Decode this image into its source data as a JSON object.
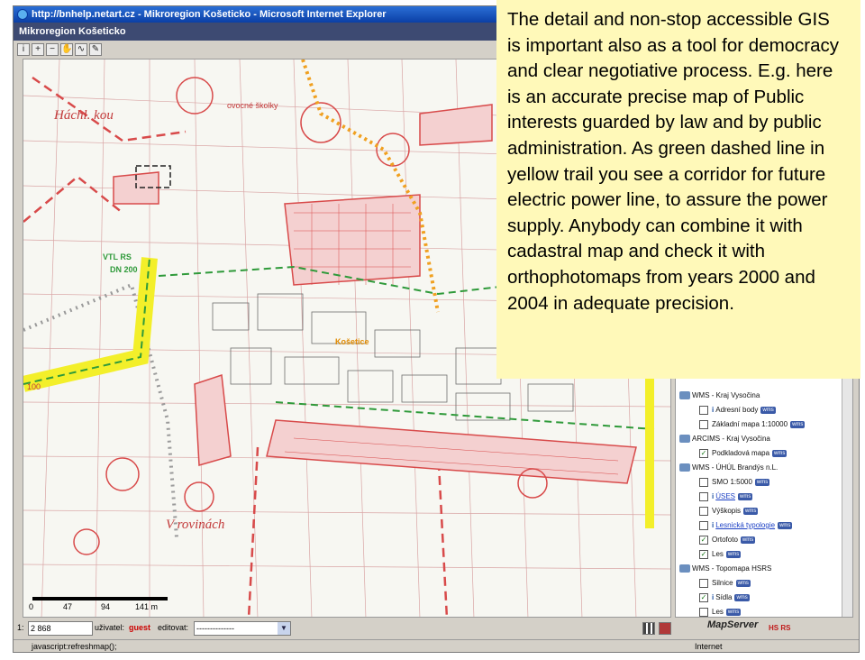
{
  "window": {
    "title": "http://bnhelp.netart.cz - Mikroregion Košeticko - Microsoft Internet Explorer"
  },
  "app": {
    "header": "Mikroregion Košeticko"
  },
  "toolbar": {
    "tools": [
      "info",
      "zoom-in",
      "zoom-out",
      "pan",
      "measure",
      "draw"
    ]
  },
  "map": {
    "labels": {
      "place_north": "Háchl. kou",
      "place_south": "V rovinách",
      "town": "Košetice",
      "corridor": "VTL RS",
      "corridor_sub": "DN 200",
      "schools": "ovocné školky",
      "line_number": "100"
    },
    "scale": {
      "ticks": [
        "0",
        "47",
        "94",
        "141 m"
      ]
    }
  },
  "layers": [
    {
      "kind": "group",
      "label": "WMS - Kraj Vysočina"
    },
    {
      "kind": "item",
      "label": "Adresní body",
      "checked": false,
      "info": true,
      "wms": true
    },
    {
      "kind": "item",
      "label": "Základní mapa 1:10000",
      "checked": false,
      "info": false,
      "wms": true
    },
    {
      "kind": "group",
      "label": "ARCIMS - Kraj Vysočina"
    },
    {
      "kind": "item",
      "label": "Podkladová mapa",
      "checked": true,
      "info": false,
      "wms": true
    },
    {
      "kind": "group",
      "label": "WMS - ÚHÚL Brandýs n.L."
    },
    {
      "kind": "item",
      "label": "SMO 1:5000",
      "checked": false,
      "info": false,
      "wms": true
    },
    {
      "kind": "item",
      "label": "ÚSES",
      "checked": false,
      "info": true,
      "wms": true,
      "link": true
    },
    {
      "kind": "item",
      "label": "Výškopis",
      "checked": false,
      "info": false,
      "wms": true
    },
    {
      "kind": "item",
      "label": "Lesnická typologie",
      "checked": false,
      "info": true,
      "wms": true,
      "link": true
    },
    {
      "kind": "item",
      "label": "Ortofoto",
      "checked": true,
      "info": false,
      "wms": true
    },
    {
      "kind": "item",
      "label": "Les",
      "checked": true,
      "info": false,
      "wms": true
    },
    {
      "kind": "group",
      "label": "WMS - Topomapa HSRS"
    },
    {
      "kind": "item",
      "label": "Silnice",
      "checked": false,
      "info": false,
      "wms": true
    },
    {
      "kind": "item",
      "label": "Sídla",
      "checked": true,
      "info": true,
      "wms": true
    },
    {
      "kind": "item",
      "label": "Les",
      "checked": false,
      "info": false,
      "wms": true
    }
  ],
  "bottom_bar": {
    "scale_prefix": "1:",
    "scale_value": "2 868",
    "user_label": "uživatel:",
    "user_name": "guest",
    "edit_label": "editovat:",
    "edit_value": "--------------",
    "logo_mapserver": "MapServer",
    "logo_hsrs": "HS RS"
  },
  "status_bar": {
    "text": "javascript:refreshmap();",
    "zone": "Internet"
  },
  "overlay": {
    "text": "The detail and non-stop accessible GIS is important also as a tool for democracy and clear negotiative process. E.g. here is an accurate precise map of Public interests guarded by law and by public administration. As green dashed line in yellow trail you see a corridor for future electric power line, to assure the power supply. Anybody can combine it with cadastral map and check it with orthophotomaps from years 2000 and 2004 in adequate precision."
  },
  "colors": {
    "map_red": "#d84a4a",
    "corridor_yellow": "#f3ef2a",
    "corridor_green": "#2f9a3a",
    "overlay_bg": "#fff9b9"
  }
}
